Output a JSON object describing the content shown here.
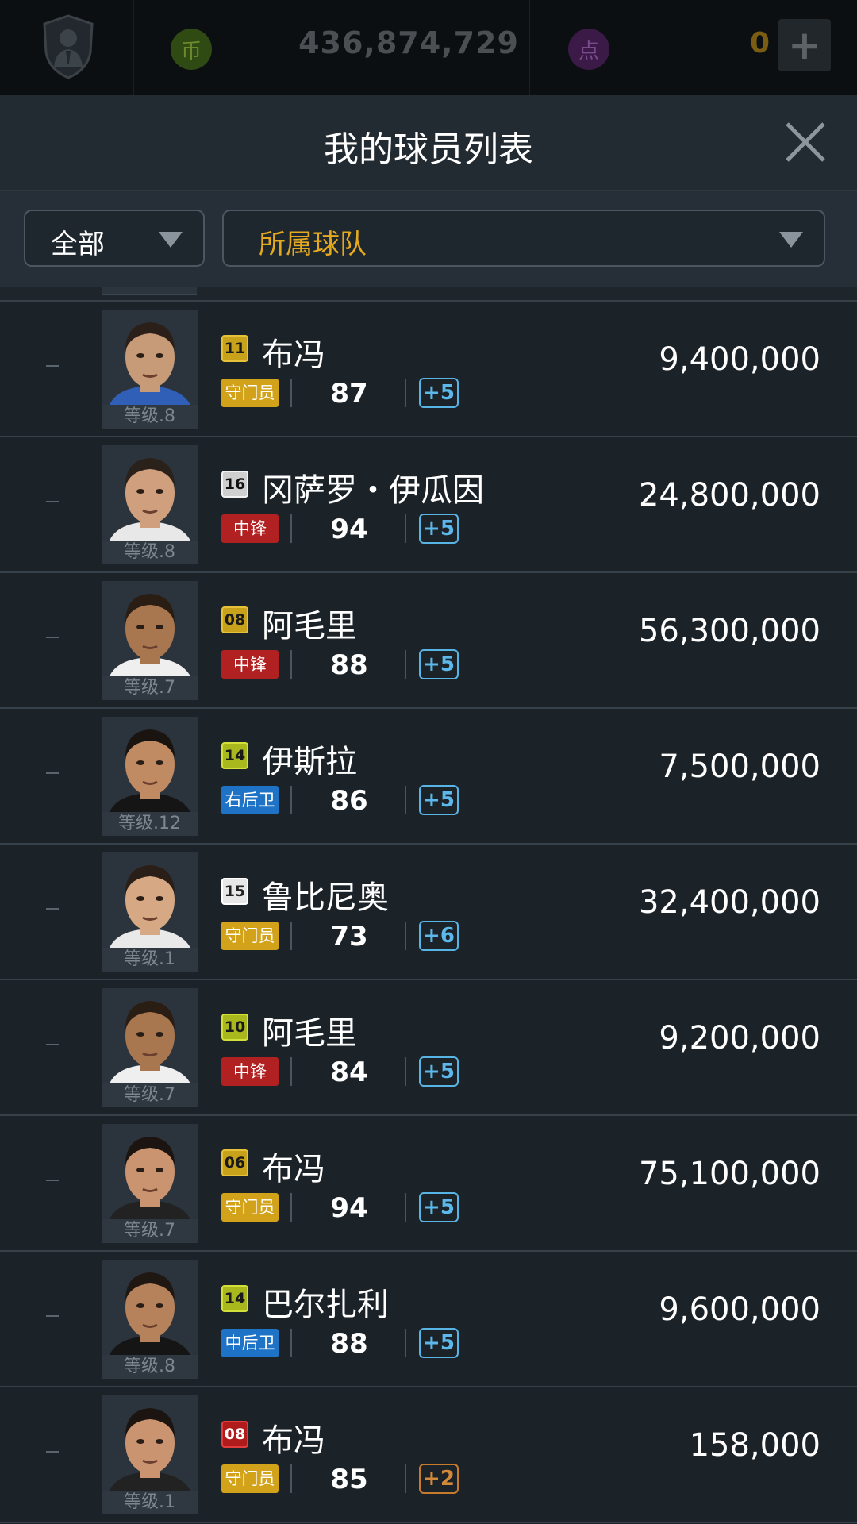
{
  "topbar": {
    "coin_icon_label": "币",
    "money": "436,874,729",
    "point_icon_label": "点",
    "points": "0",
    "add_label": "+"
  },
  "header": {
    "title": "我的球员列表"
  },
  "filters": {
    "category": "全部",
    "team": "所属球队"
  },
  "players": [
    {
      "dash": "–",
      "number": "11",
      "name": "布冯",
      "position": "守门员",
      "rating": "87",
      "plus": "+5",
      "price": "9,400,000",
      "level": "等级.8"
    },
    {
      "dash": "–",
      "number": "16",
      "name": "冈萨罗・伊瓜因",
      "position": "中锋",
      "rating": "94",
      "plus": "+5",
      "price": "24,800,000",
      "level": "等级.8"
    },
    {
      "dash": "–",
      "number": "08",
      "name": "阿毛里",
      "position": "中锋",
      "rating": "88",
      "plus": "+5",
      "price": "56,300,000",
      "level": "等级.7"
    },
    {
      "dash": "–",
      "number": "14",
      "name": "伊斯拉",
      "position": "右后卫",
      "rating": "86",
      "plus": "+5",
      "price": "7,500,000",
      "level": "等级.12"
    },
    {
      "dash": "–",
      "number": "15",
      "name": "鲁比尼奥",
      "position": "守门员",
      "rating": "73",
      "plus": "+6",
      "price": "32,400,000",
      "level": "等级.1"
    },
    {
      "dash": "–",
      "number": "10",
      "name": "阿毛里",
      "position": "中锋",
      "rating": "84",
      "plus": "+5",
      "price": "9,200,000",
      "level": "等级.7"
    },
    {
      "dash": "–",
      "number": "06",
      "name": "布冯",
      "position": "守门员",
      "rating": "94",
      "plus": "+5",
      "price": "75,100,000",
      "level": "等级.7"
    },
    {
      "dash": "–",
      "number": "14",
      "name": "巴尔扎利",
      "position": "中后卫",
      "rating": "88",
      "plus": "+5",
      "price": "9,600,000",
      "level": "等级.8"
    },
    {
      "dash": "–",
      "number": "08",
      "name": "布冯",
      "position": "守门员",
      "rating": "85",
      "plus": "+2",
      "price": "158,000",
      "level": "等级.1"
    }
  ]
}
